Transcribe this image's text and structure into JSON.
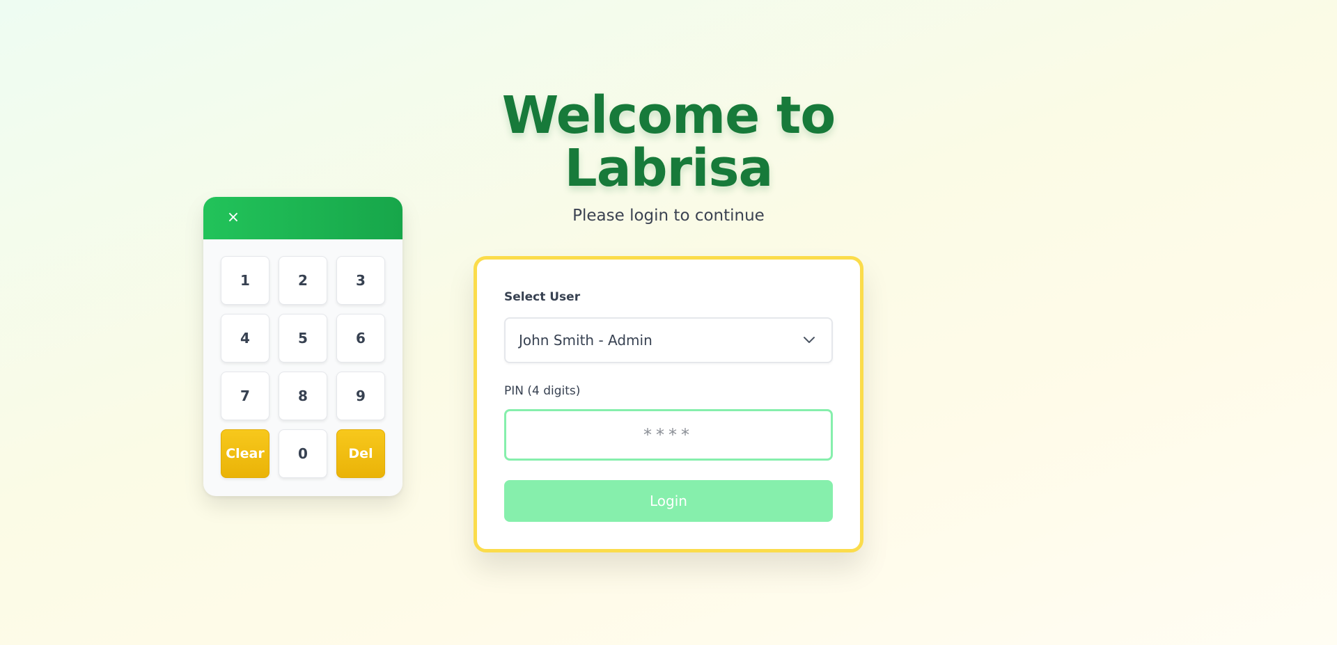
{
  "header": {
    "title_line1": "Welcome to",
    "title_line2": "Labrisa",
    "subtitle": "Please login to continue"
  },
  "keypad": {
    "close_icon": "×",
    "keys": [
      "1",
      "2",
      "3",
      "4",
      "5",
      "6",
      "7",
      "8",
      "9",
      "Clear",
      "0",
      "Del"
    ]
  },
  "login": {
    "user_label": "Select User",
    "selected_user": "John Smith - Admin",
    "pin_label": "PIN (4 digits)",
    "pin_placeholder": "****",
    "login_label": "Login"
  },
  "colors": {
    "brand_green": "#177a3a",
    "keypad_header": "#22c35a",
    "action_key": "#eab308",
    "card_border": "#fbdc4b",
    "pin_border": "#86efac",
    "login_button": "#86efac"
  },
  "icons": {
    "keypad_close": "close-icon",
    "select_chevron": "chevron-down-icon"
  }
}
